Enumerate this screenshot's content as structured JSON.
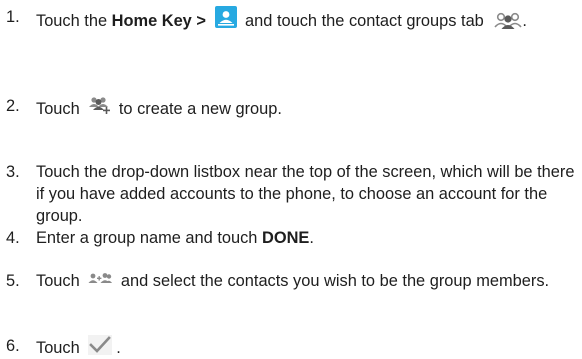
{
  "steps": [
    {
      "number": "1.",
      "t1": "Touch the ",
      "bold1": "Home Key >",
      "icon1": "contacts-app-icon",
      "t2": " and touch the contact groups tab ",
      "icon2": "contact-groups-tab-icon",
      "t3": "."
    },
    {
      "number": "2.",
      "t1": "Touch ",
      "icon1": "add-group-icon",
      "t2": " to create a new group."
    },
    {
      "number": "3.",
      "text": "Touch the drop-down listbox near the top of the screen, which will be there if you have added accounts to the phone, to choose an account for the group."
    },
    {
      "number": "4.",
      "t1": "Enter a group name and touch ",
      "bold1": "DONE",
      "t2": "."
    },
    {
      "number": "5.",
      "t1": "Touch ",
      "icon1": "add-members-icon",
      "t2": " and select the contacts you wish to be the group members."
    },
    {
      "number": "6.",
      "t1": "Touch ",
      "icon1": "checkmark-icon",
      "t2": "."
    }
  ],
  "colors": {
    "text": "#1e1e1e",
    "contacts_icon_bg": "#27a9e1",
    "icon_gray": "#8a8a8a",
    "icon_dark": "#5a5a5a"
  }
}
